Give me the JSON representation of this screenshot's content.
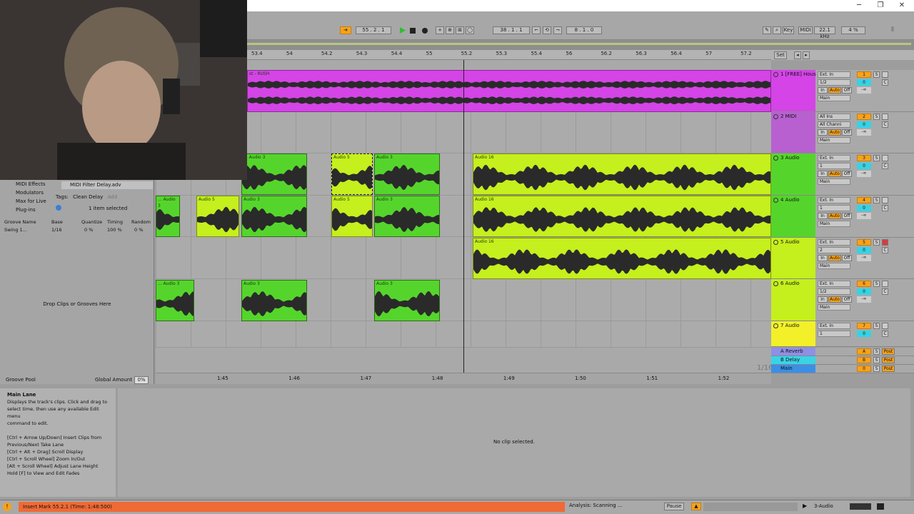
{
  "window": {
    "minimize": "─",
    "restore": "❐",
    "close": "✕"
  },
  "transport": {
    "position": "55 . 2 . 1",
    "loop_start": "38 . 1 . 1",
    "loop_length": "8 . 1 . 0",
    "key_label": "Key",
    "midi_label": "MIDI",
    "sample_rate": "22.1 kHz",
    "cpu": "4 %"
  },
  "ruler": {
    "bars": [
      "53.4",
      "54",
      "54.2",
      "54.3",
      "54.4",
      "55",
      "55.2",
      "55.3",
      "55.4",
      "56",
      "56.2",
      "56.3",
      "56.4",
      "57",
      "57.2"
    ],
    "set_label": "Set"
  },
  "timeline": {
    "times": [
      "1:45",
      "1:46",
      "1:47",
      "1:48",
      "1:49",
      "1:50",
      "1:51",
      "1:52"
    ],
    "grid": "1/16"
  },
  "tracks": [
    {
      "name": "1 [FREE] Hous",
      "input": "Ext. In",
      "channel": "1/2",
      "number": "1",
      "color": "#f7a21b"
    },
    {
      "name": "2 MIDI",
      "input": "All Ins",
      "channel": "All Channi",
      "number": "2",
      "color": "#f7a21b"
    },
    {
      "name": "3 Audio",
      "input": "Ext. In",
      "channel": "1",
      "number": "3",
      "color": "#f7a21b"
    },
    {
      "name": "4 Audio",
      "input": "Ext. In",
      "channel": "1",
      "number": "4",
      "color": "#f7a21b"
    },
    {
      "name": "5 Audio",
      "input": "Ext. In",
      "channel": "2",
      "number": "5",
      "color": "#f7a21b"
    },
    {
      "name": "6 Audio",
      "input": "Ext. In",
      "channel": "1/2",
      "number": "6",
      "color": "#f7a21b"
    },
    {
      "name": "7 Audio",
      "input": "Ext. In",
      "channel": "1",
      "number": "7",
      "color": "#f7a21b"
    }
  ],
  "returns": [
    {
      "name": "A Reverb",
      "letter": "A"
    },
    {
      "name": "B Delay",
      "letter": "B"
    },
    {
      "name": "Main",
      "letter": "0"
    }
  ],
  "mixer": {
    "in": "In",
    "auto": "Auto",
    "off": "Off",
    "main": "Main",
    "zero": "0",
    "s": "S",
    "c": "C",
    "inf": "-∞",
    "post": "Post",
    "half": "1/2"
  },
  "clips": {
    "rush": "st - RUSH",
    "audio3": "Audio 3",
    "audio5": "Audio 5",
    "audio16": "Audio 16",
    "trunc3": "... Audio 3"
  },
  "browser": {
    "categories": [
      "MIDI Effects",
      "Modulators",
      "Max for Live",
      "Plug-ins"
    ],
    "file": "MIDI Filter Delay.adv",
    "tags_label": "Tags:",
    "tag": "Clean Delay",
    "add": "Add",
    "selected": "1 item selected",
    "groove_headers": [
      "Groove Name",
      "Base",
      "Quantize",
      "Timing",
      "Random"
    ],
    "groove_row": {
      "name": "Swing 1...",
      "base": "1/16",
      "quantize": "0 %",
      "timing": "100 %",
      "random": "0 %"
    },
    "drop_text": "Drop Clips or Grooves Here",
    "pool_label": "Groove Pool",
    "global_label": "Global Amount",
    "global_value": "0%"
  },
  "help": {
    "title": "Main Lane",
    "lines": [
      "Displays the track's clips. Click and drag to",
      "select time, then use any available Edit menu",
      "command to edit.",
      "",
      "[Ctrl + Arrow Up/Down] Insert Clips from",
      "Previous/Next Take Lane",
      "[Ctrl + Alt + Drag] Scroll Display",
      "[Ctrl + Scroll Wheel] Zoom In/Out",
      "[Alt + Scroll Wheel] Adjust Lane Height",
      "Hold [F] to View and Edit Fades"
    ]
  },
  "detail": {
    "empty": "No clip selected."
  },
  "status": {
    "message": "Insert Mark 55.2.1 (Time: 1:48:500)",
    "analysis": "Analysis: Scanning ...",
    "pause": "Pause",
    "track": "3-Audio"
  },
  "colors": {
    "green": "#55d52c",
    "yellow": "#c5ef1d",
    "magenta": "#d444e6",
    "orange": "#f7a21b"
  }
}
